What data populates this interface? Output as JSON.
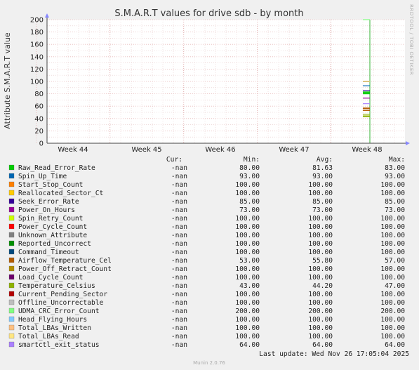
{
  "title": "S.M.A.R.T values for drive sdb - by month",
  "watermark": "RRDTOOL / TOBI OETIKER",
  "footer": "Munin 2.0.76",
  "last_update": "Last update: Wed Nov 26 17:05:04 2025",
  "legend_headers": {
    "cur": "Cur:",
    "min": "Min:",
    "avg": "Avg:",
    "max": "Max:"
  },
  "chart_data": {
    "type": "line",
    "title": "S.M.A.R.T values for drive sdb - by month",
    "ylabel": "Attribute S.M.A.R.T value",
    "xlabel": "",
    "ylim": [
      0,
      200
    ],
    "yticks": [
      0,
      20,
      40,
      60,
      80,
      100,
      120,
      140,
      160,
      180,
      200
    ],
    "xticks": [
      "Week 44",
      "Week 45",
      "Week 46",
      "Week 47",
      "Week 48"
    ],
    "grid": true,
    "data_window": "end of Week 48",
    "series": [
      {
        "name": "Raw_Read_Error_Rate",
        "color": "#00cc00",
        "cur": "-nan",
        "min": "80.00",
        "avg": "81.63",
        "max": "83.00"
      },
      {
        "name": "Spin_Up_Time",
        "color": "#0066b3",
        "cur": "-nan",
        "min": "93.00",
        "avg": "93.00",
        "max": "93.00"
      },
      {
        "name": "Start_Stop_Count",
        "color": "#ff8000",
        "cur": "-nan",
        "min": "100.00",
        "avg": "100.00",
        "max": "100.00"
      },
      {
        "name": "Reallocated_Sector_Ct",
        "color": "#ffcc00",
        "cur": "-nan",
        "min": "100.00",
        "avg": "100.00",
        "max": "100.00"
      },
      {
        "name": "Seek_Error_Rate",
        "color": "#330099",
        "cur": "-nan",
        "min": "85.00",
        "avg": "85.00",
        "max": "85.00"
      },
      {
        "name": "Power_On_Hours",
        "color": "#990099",
        "cur": "-nan",
        "min": "73.00",
        "avg": "73.00",
        "max": "73.00"
      },
      {
        "name": "Spin_Retry_Count",
        "color": "#ccff00",
        "cur": "-nan",
        "min": "100.00",
        "avg": "100.00",
        "max": "100.00"
      },
      {
        "name": "Power_Cycle_Count",
        "color": "#ff0000",
        "cur": "-nan",
        "min": "100.00",
        "avg": "100.00",
        "max": "100.00"
      },
      {
        "name": "Unknown_Attribute",
        "color": "#808080",
        "cur": "-nan",
        "min": "100.00",
        "avg": "100.00",
        "max": "100.00"
      },
      {
        "name": "Reported_Uncorrect",
        "color": "#008f00",
        "cur": "-nan",
        "min": "100.00",
        "avg": "100.00",
        "max": "100.00"
      },
      {
        "name": "Command_Timeout",
        "color": "#00487d",
        "cur": "-nan",
        "min": "100.00",
        "avg": "100.00",
        "max": "100.00"
      },
      {
        "name": "Airflow_Temperature_Cel",
        "color": "#b35a00",
        "cur": "-nan",
        "min": "53.00",
        "avg": "55.80",
        "max": "57.00"
      },
      {
        "name": "Power_Off_Retract_Count",
        "color": "#b38f00",
        "cur": "-nan",
        "min": "100.00",
        "avg": "100.00",
        "max": "100.00"
      },
      {
        "name": "Load_Cycle_Count",
        "color": "#6b006b",
        "cur": "-nan",
        "min": "100.00",
        "avg": "100.00",
        "max": "100.00"
      },
      {
        "name": "Temperature_Celsius",
        "color": "#8fb300",
        "cur": "-nan",
        "min": "43.00",
        "avg": "44.20",
        "max": "47.00"
      },
      {
        "name": "Current_Pending_Sector",
        "color": "#b30000",
        "cur": "-nan",
        "min": "100.00",
        "avg": "100.00",
        "max": "100.00"
      },
      {
        "name": "Offline_Uncorrectable",
        "color": "#bebebe",
        "cur": "-nan",
        "min": "100.00",
        "avg": "100.00",
        "max": "100.00"
      },
      {
        "name": "UDMA_CRC_Error_Count",
        "color": "#80ff80",
        "cur": "-nan",
        "min": "200.00",
        "avg": "200.00",
        "max": "200.00"
      },
      {
        "name": "Head_Flying_Hours",
        "color": "#80c9ff",
        "cur": "-nan",
        "min": "100.00",
        "avg": "100.00",
        "max": "100.00"
      },
      {
        "name": "Total_LBAs_Written",
        "color": "#ffc080",
        "cur": "-nan",
        "min": "100.00",
        "avg": "100.00",
        "max": "100.00"
      },
      {
        "name": "Total_LBAs_Read",
        "color": "#ffe680",
        "cur": "-nan",
        "min": "100.00",
        "avg": "100.00",
        "max": "100.00"
      },
      {
        "name": "smartctl_exit_status",
        "color": "#aa80ff",
        "cur": "-nan",
        "min": "64.00",
        "avg": "64.00",
        "max": "64.00"
      }
    ]
  }
}
